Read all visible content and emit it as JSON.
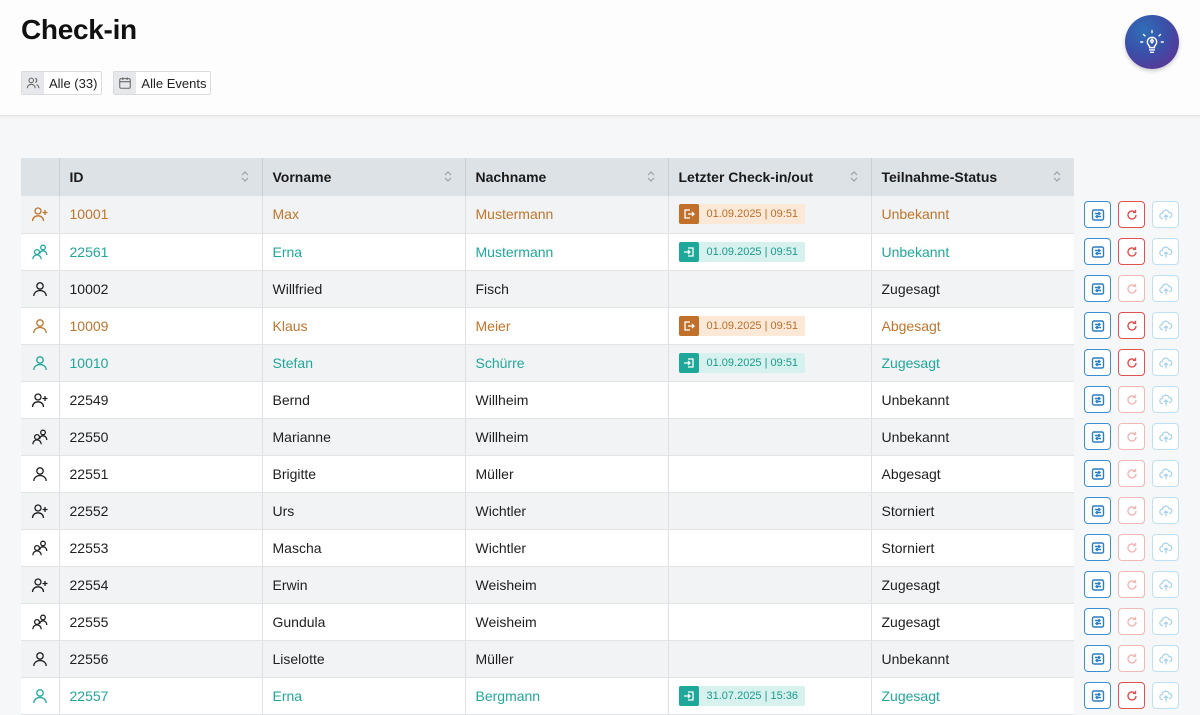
{
  "page": {
    "title": "Check-in"
  },
  "filters": [
    {
      "label": "Alle (33)",
      "icon": "users-icon"
    },
    {
      "label": "Alle Events",
      "icon": "calendar-icon"
    }
  ],
  "colors": {
    "orange": "#c0752a",
    "teal": "#1fa89a",
    "dark": "#1e1e1e",
    "accent_blue": "#3b8fd1",
    "accent_red": "#e05252"
  },
  "table": {
    "columns": [
      "ID",
      "Vorname",
      "Nachname",
      "Letzter Check-in/out",
      "Teilnahme-Status"
    ],
    "rows": [
      {
        "icon": "user-plus",
        "tone": "orange",
        "id": "10001",
        "first": "Max",
        "last": "Mustermann",
        "check": {
          "type": "out",
          "text": "01.09.2025 | 09:51"
        },
        "status": "Unbekannt",
        "undo_active": true
      },
      {
        "icon": "user-group",
        "tone": "teal",
        "id": "22561",
        "first": "Erna",
        "last": "Mustermann",
        "check": {
          "type": "in",
          "text": "01.09.2025 | 09:51"
        },
        "status": "Unbekannt",
        "undo_active": true
      },
      {
        "icon": "user",
        "tone": "dark",
        "id": "10002",
        "first": "Willfried",
        "last": "Fisch",
        "check": null,
        "status": "Zugesagt",
        "undo_active": false
      },
      {
        "icon": "user",
        "tone": "orange",
        "id": "10009",
        "first": "Klaus",
        "last": "Meier",
        "check": {
          "type": "out",
          "text": "01.09.2025 | 09:51"
        },
        "status": "Abgesagt",
        "undo_active": true
      },
      {
        "icon": "user",
        "tone": "teal",
        "id": "10010",
        "first": "Stefan",
        "last": "Schürre",
        "check": {
          "type": "in",
          "text": "01.09.2025 | 09:51"
        },
        "status": "Zugesagt",
        "undo_active": true
      },
      {
        "icon": "user-plus",
        "tone": "dark",
        "id": "22549",
        "first": "Bernd",
        "last": "Willheim",
        "check": null,
        "status": "Unbekannt",
        "undo_active": false
      },
      {
        "icon": "user-group",
        "tone": "dark",
        "id": "22550",
        "first": "Marianne",
        "last": "Willheim",
        "check": null,
        "status": "Unbekannt",
        "undo_active": false
      },
      {
        "icon": "user",
        "tone": "dark",
        "id": "22551",
        "first": "Brigitte",
        "last": "Müller",
        "check": null,
        "status": "Abgesagt",
        "undo_active": false
      },
      {
        "icon": "user-plus",
        "tone": "dark",
        "id": "22552",
        "first": "Urs",
        "last": "Wichtler",
        "check": null,
        "status": "Storniert",
        "undo_active": false
      },
      {
        "icon": "user-group",
        "tone": "dark",
        "id": "22553",
        "first": "Mascha",
        "last": "Wichtler",
        "check": null,
        "status": "Storniert",
        "undo_active": false
      },
      {
        "icon": "user-plus",
        "tone": "dark",
        "id": "22554",
        "first": "Erwin",
        "last": "Weisheim",
        "check": null,
        "status": "Zugesagt",
        "undo_active": false
      },
      {
        "icon": "user-group",
        "tone": "dark",
        "id": "22555",
        "first": "Gundula",
        "last": "Weisheim",
        "check": null,
        "status": "Zugesagt",
        "undo_active": false
      },
      {
        "icon": "user",
        "tone": "dark",
        "id": "22556",
        "first": "Liselotte",
        "last": "Müller",
        "check": null,
        "status": "Unbekannt",
        "undo_active": false
      },
      {
        "icon": "user",
        "tone": "teal",
        "id": "22557",
        "first": "Erna",
        "last": "Bergmann",
        "check": {
          "type": "in",
          "text": "31.07.2025 | 15:36"
        },
        "status": "Zugesagt",
        "undo_active": true
      }
    ]
  }
}
